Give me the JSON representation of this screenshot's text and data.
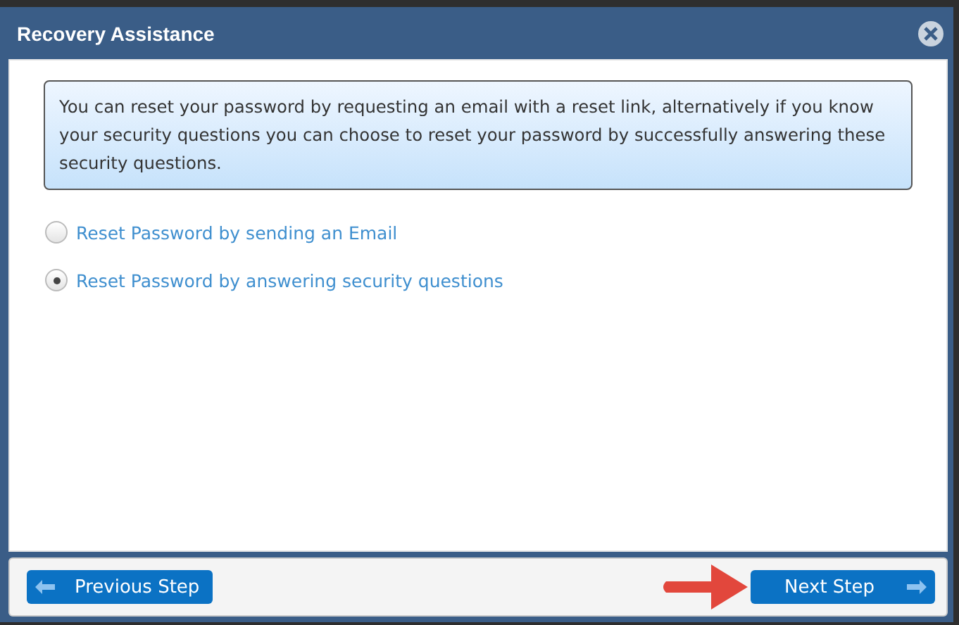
{
  "window": {
    "title": "Recovery Assistance"
  },
  "info": "You can reset your password by requesting an email with a reset link, alternatively if you know your security questions you can choose to reset your password by successfully answering these security questions.",
  "options": [
    {
      "label": "Reset Password by sending an Email",
      "selected": false
    },
    {
      "label": "Reset Password by answering security questions",
      "selected": true
    }
  ],
  "buttons": [
    {
      "kind": "previous",
      "label": "Previous Step"
    },
    {
      "kind": "next",
      "label": "Next Step"
    }
  ]
}
